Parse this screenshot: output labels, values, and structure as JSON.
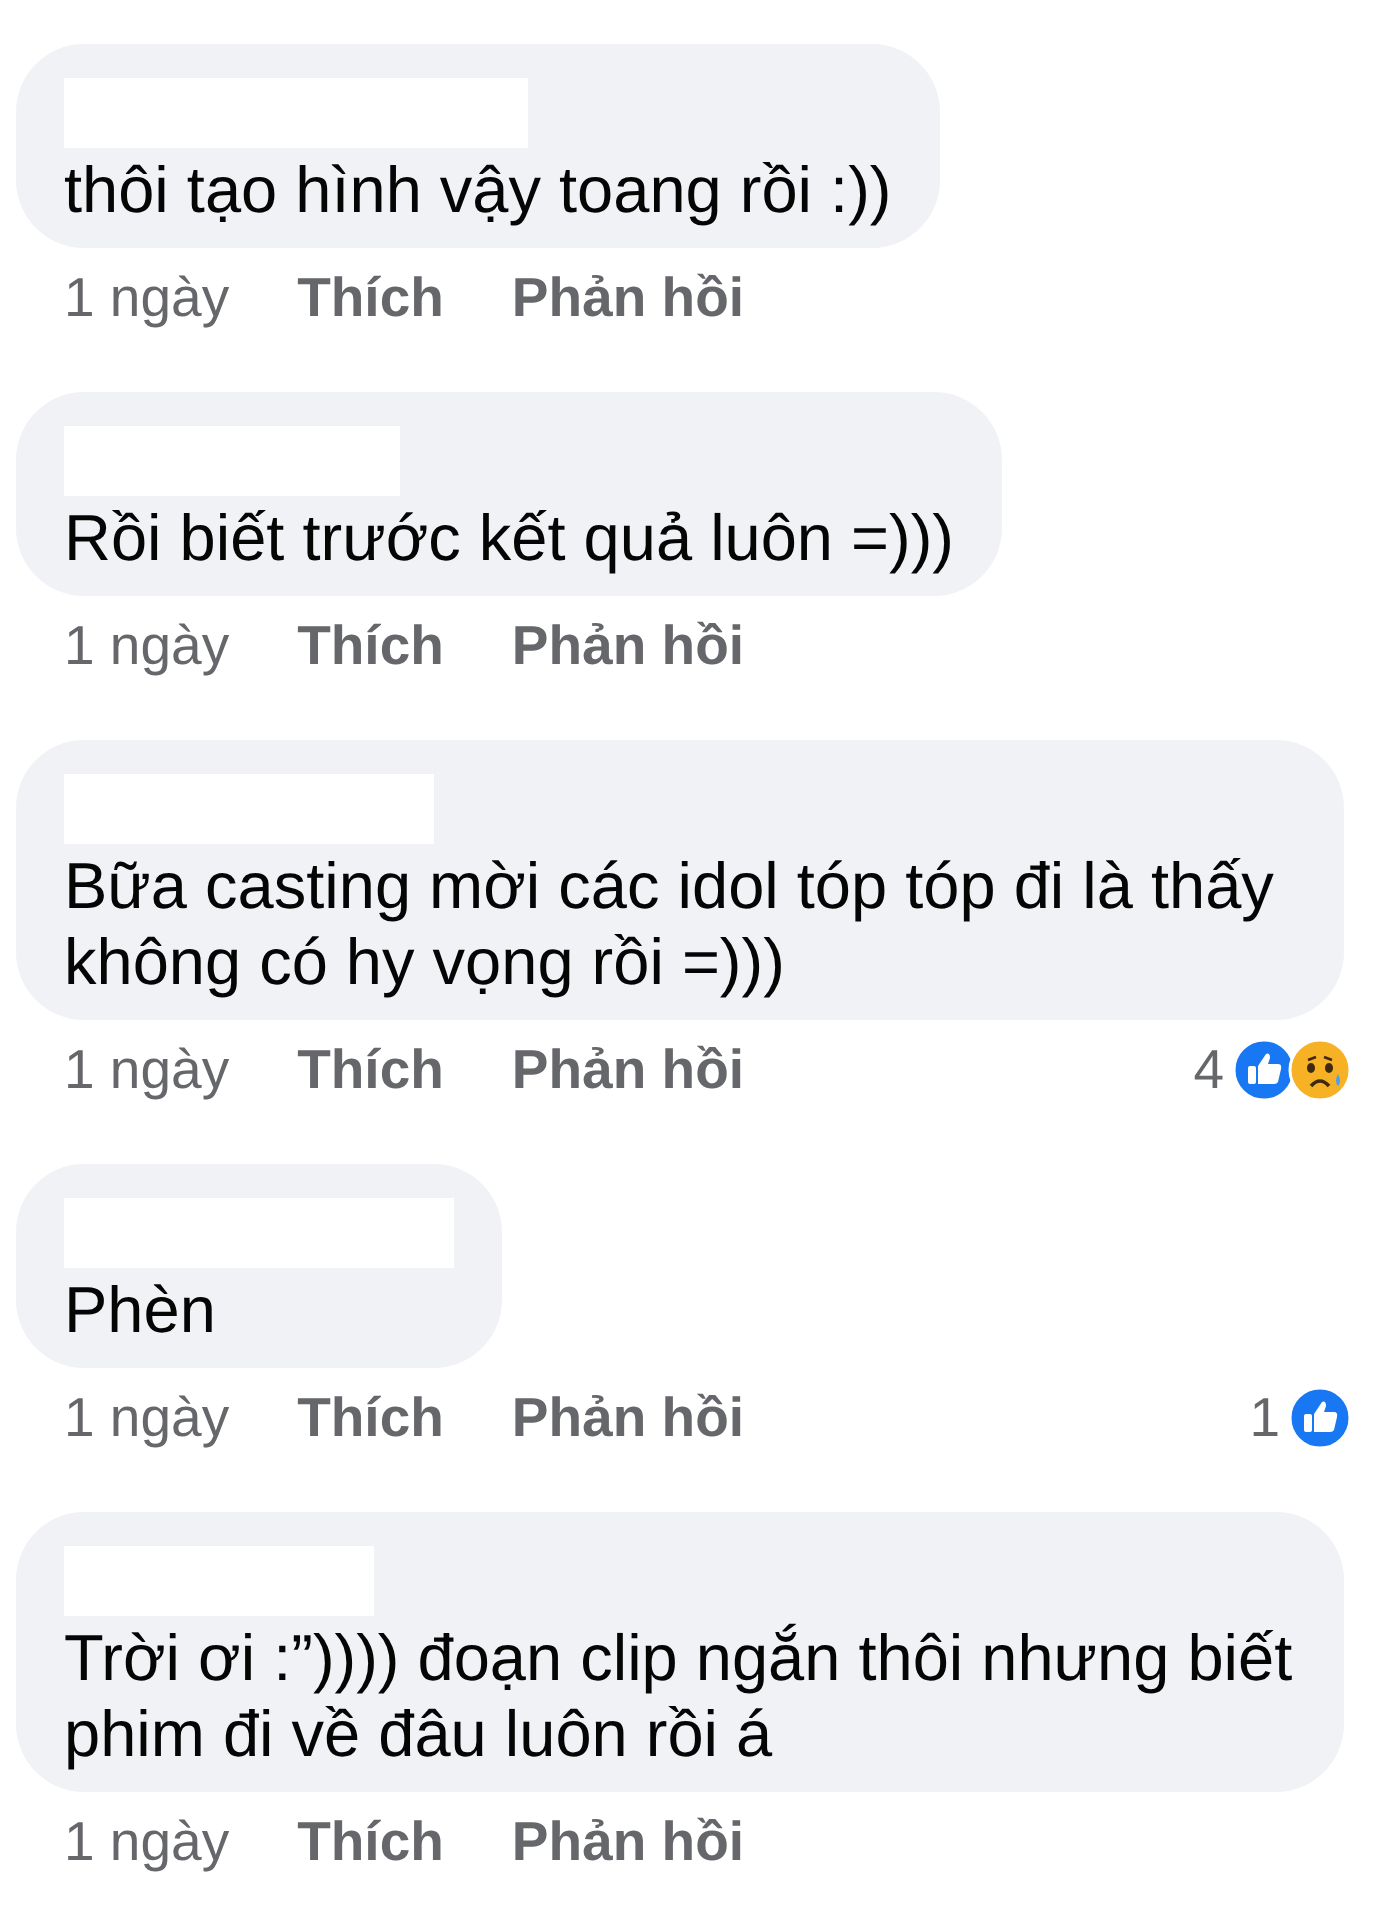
{
  "comments": [
    {
      "text": "thôi tạo hình vậy toang rồi :))",
      "time": "1 ngày",
      "actions": [
        "Thích",
        "Phản hồi"
      ]
    },
    {
      "text": "Rồi biết trước kết quả luôn =)))",
      "time": "1 ngày",
      "actions": [
        "Thích",
        "Phản hồi"
      ]
    },
    {
      "text": "Bữa casting mời các idol tóp tóp đi là thấy không có hy vọng rồi =)))",
      "time": "1 ngày",
      "actions": [
        "Thích",
        "Phản hồi"
      ],
      "reactions": {
        "count": "4",
        "types": [
          {
            "kind": "like"
          },
          {
            "kind": "sad"
          }
        ]
      }
    },
    {
      "text": "Phèn",
      "time": "1 ngày",
      "actions": [
        "Thích",
        "Phản hồi"
      ],
      "reactions": {
        "count": "1",
        "types": [
          {
            "kind": "like"
          }
        ]
      }
    },
    {
      "text": "Trời ơi :”)))) đoạn clip ngắn thôi nhưng biết phim đi về đâu luôn rồi á",
      "time": "1 ngày",
      "actions": [
        "Thích",
        "Phản hồi"
      ]
    }
  ]
}
